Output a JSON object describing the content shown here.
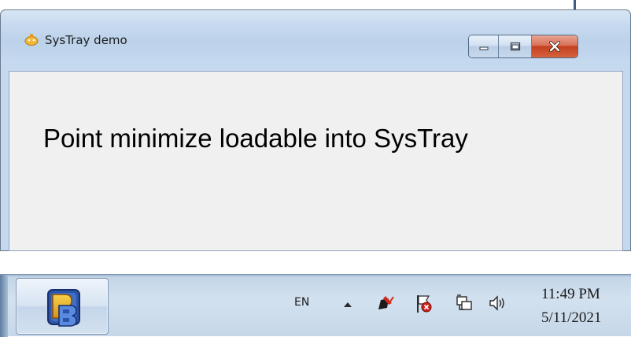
{
  "window": {
    "title": "SysTray demo",
    "icon": "systray-app-icon",
    "buttons": {
      "minimize": "minimize-icon",
      "maximize": "maximize-icon",
      "close": "close-icon"
    },
    "content_text": "Point minimize loadable into SysTray"
  },
  "taskbar": {
    "app_button_icon": "powerbuilder-icon",
    "language": "EN",
    "tray_icons": [
      "show-hidden-icons-arrow",
      "flag-icon",
      "action-center-icon",
      "network-icon",
      "volume-icon"
    ],
    "clock": {
      "time": "11:49 PM",
      "date": "5/11/2021"
    }
  },
  "colors": {
    "close_button": "#c4401f",
    "window_frame": "#c4d8ee",
    "client_area": "#f0f0f0"
  }
}
